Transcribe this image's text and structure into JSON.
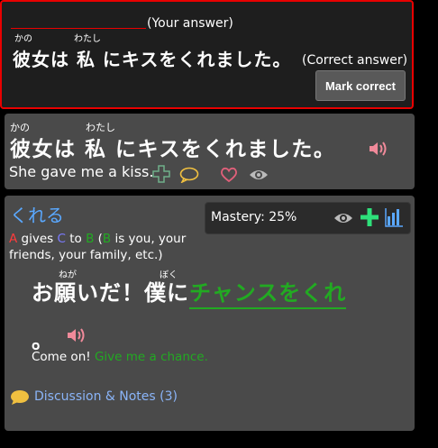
{
  "review": {
    "your_answer_label": "(Your answer)",
    "ruby": [
      "かの",
      "わたし"
    ],
    "correct_sentence": "彼女は 私 にキスをくれました。",
    "correct_label": "(Correct answer)",
    "mark_correct_label": "Mark correct"
  },
  "sentence": {
    "ruby": [
      "かの",
      "わたし"
    ],
    "japanese": "彼女は 私 にキスをくれました。",
    "english": "She gave me a kiss."
  },
  "grammar": {
    "title": "くれる",
    "desc": {
      "a": "A",
      "t1": " gives ",
      "c": "C",
      "t2": " to ",
      "b": "B",
      "t3": " (",
      "b2": "B",
      "t4": " is you, your friends, your family, etc.)"
    },
    "mastery_label": "Mastery: 25%",
    "mastery_percent": 25,
    "example": {
      "ruby": [
        "ねが",
        "ぼく"
      ],
      "jp_plain": "お願いだ！僕に",
      "jp_green": "チャンスをくれ",
      "jp_end": "。",
      "en_plain": "Come on!",
      "en_green": "Give me a chance."
    },
    "discussion_label": "Discussion & Notes (3)"
  },
  "colors": {
    "error_border": "#e80000",
    "link_blue": "#5aa8ff",
    "green": "#22aa22",
    "speaker": "#f08a9a",
    "heart": "#e0607a",
    "bubble": "#f0c040"
  },
  "icons": [
    "speaker-icon",
    "plus-outline-icon",
    "speech-bubble-icon",
    "heart-icon",
    "eye-icon",
    "plus-icon",
    "bar-chart-icon"
  ]
}
